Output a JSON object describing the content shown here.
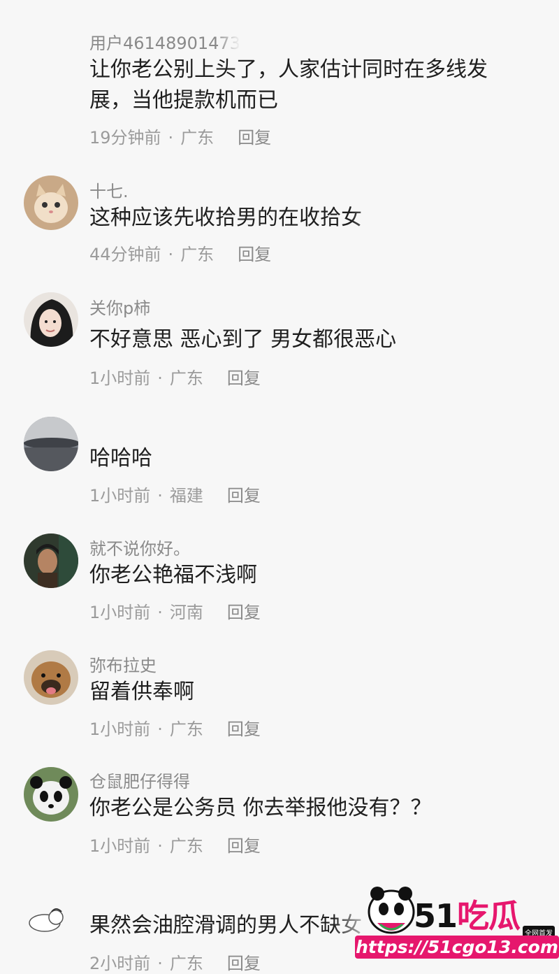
{
  "comments": [
    {
      "user": "用户46148901473",
      "text": "让你老公别上头了，人家估计同时在多线发展，当他提款机而已",
      "time": "19分钟前",
      "region": "广东",
      "reply": "回复",
      "avatar": "none"
    },
    {
      "user": "十七.",
      "text": "这种应该先收拾男的在收拾女",
      "time": "44分钟前",
      "region": "广东",
      "reply": "回复",
      "avatar": "cat-avatar"
    },
    {
      "user": "关你p柿",
      "text": "不好意思 恶心到了 男女都很恶心",
      "time": "1小时前",
      "region": "广东",
      "reply": "回复",
      "avatar": "girl-avatar"
    },
    {
      "user": "",
      "text": "哈哈哈",
      "time": "1小时前",
      "region": "福建",
      "reply": "回复",
      "avatar": "sky-avatar"
    },
    {
      "user": "就不说你好。",
      "text": "你老公艳福不浅啊",
      "time": "1小时前",
      "region": "河南",
      "reply": "回复",
      "avatar": "man-avatar"
    },
    {
      "user": "弥布拉史",
      "text": "留着供奉啊",
      "time": "1小时前",
      "region": "广东",
      "reply": "回复",
      "avatar": "dog-avatar"
    },
    {
      "user": "仓鼠肥仔得得",
      "text": "你老公是公务员 你去举报他没有？？",
      "time": "1小时前",
      "region": "广东",
      "reply": "回复",
      "avatar": "panda-avatar"
    },
    {
      "user": "",
      "text": "果然会油腔滑调的男人不缺女",
      "time": "2小时前",
      "region": "广东",
      "reply": "回复",
      "avatar": "cartoon-avatar"
    }
  ],
  "watermark": {
    "brand_num": "51",
    "brand_text": "吃瓜",
    "badge": "全网首发",
    "url": "https://51cgo13.com"
  },
  "colors": {
    "background": "#f7f7f7",
    "meta": "#9b9b9b",
    "brand_pink": "#e6176d"
  }
}
